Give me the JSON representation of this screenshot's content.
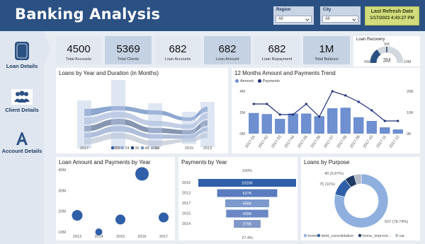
{
  "header": {
    "title": "Banking Analysis",
    "region": {
      "label": "Region",
      "value": "All"
    },
    "city": {
      "label": "City",
      "value": "All"
    },
    "refresh_label": "Last Refresh Date",
    "refresh_value": "1/17/2023 4:43:27 PM"
  },
  "nav": [
    {
      "label": "Loan Details",
      "icon": "document-icon"
    },
    {
      "label": "Client Details",
      "icon": "people-icon"
    },
    {
      "label": "Account Details",
      "icon": "letter-a-icon"
    }
  ],
  "kpis": [
    {
      "value": "4500",
      "label": "Total Accounts"
    },
    {
      "value": "5369",
      "label": "Total Clients"
    },
    {
      "value": "682",
      "label": "Loan Accounts"
    },
    {
      "value": "682",
      "label": "Loan Amount"
    },
    {
      "value": "682",
      "label": "Loan Repayment"
    },
    {
      "value": "1M",
      "label": "Total Balance"
    }
  ],
  "gauge": {
    "title": "Loan Recovery",
    "min_label": "0M",
    "max_label": "10M",
    "target_label": "5M",
    "value_label": "3M",
    "value_fraction": 0.3
  },
  "ribbon": {
    "title": "Loans by Year and Duration (in Months)",
    "x_labels": [
      "2017",
      "2016",
      "2014",
      "2015",
      "2013"
    ],
    "legend": [
      "12",
      "24",
      "36",
      "48",
      "60"
    ],
    "colors": [
      "#2f5fa8",
      "#8ea6cf",
      "#233f72",
      "#6e8bbd",
      "#a9b5c6"
    ]
  },
  "trend": {
    "title": "12 Months Amount and Payments Trend",
    "legend_amount": "Amount",
    "legend_payments": "Payments",
    "y_left": [
      "4M",
      "2M",
      "0M"
    ],
    "y_right": [
      "20K",
      "10K",
      "0K"
    ]
  },
  "scatter": {
    "title": "Loan Amount and Payments by Year",
    "y_ticks": [
      "40M",
      "30M",
      "20M",
      "10M"
    ]
  },
  "funnel": {
    "title": "Payments by Year",
    "top_label": "100%",
    "bottom_label": "27.4%",
    "rows": [
      {
        "year": "2016",
        "label": "1020K",
        "value": 1020
      },
      {
        "year": "2013",
        "label": "627K",
        "value": 627
      },
      {
        "year": "2017",
        "label": "458K",
        "value": 458
      },
      {
        "year": "2015",
        "label": "439K",
        "value": 439
      },
      {
        "year": "2014",
        "label": "279K",
        "value": 279
      }
    ]
  },
  "donut": {
    "title": "Loans by Purpose",
    "labels": [
      "40 (5.87%)",
      "75 (11%)",
      "537 (78.74%)"
    ],
    "legend": [
      "home",
      "debt_consolidation",
      "home_improve...",
      "car"
    ],
    "colors": [
      "#8fb0de",
      "#2f5fa8",
      "#1f3a64",
      "#b5bdc8"
    ]
  },
  "chart_data": [
    {
      "type": "bar",
      "title": "12 Months Amount and Payments Trend",
      "categories": [
        "2017-01",
        "2017-02",
        "2017-03",
        "2017-04",
        "2017-05",
        "2017-06",
        "2017-07",
        "2017-08",
        "2017-09",
        "2017-10",
        "2017-11",
        "2017-12"
      ],
      "series": [
        {
          "name": "Amount",
          "axis": "left",
          "values": [
            1.95,
            1.85,
            1.4,
            1.9,
            1.9,
            1.65,
            2.4,
            2.45,
            1.55,
            1.2,
            0.6,
            0.4
          ]
        },
        {
          "name": "Payments",
          "type": "line",
          "axis": "right",
          "values": [
            14,
            14,
            9,
            9,
            14,
            8,
            20,
            18,
            15,
            11,
            6,
            6
          ]
        }
      ],
      "ylim": [
        0,
        4
      ],
      "ylim_right": [
        0,
        20
      ]
    },
    {
      "type": "scatter",
      "title": "Loan Amount and Payments by Year",
      "x": [
        2013,
        2014,
        2015,
        2016,
        2017
      ],
      "y": [
        18,
        10,
        16,
        38,
        17
      ],
      "x_labels": [
        "2013",
        "2014",
        "2015",
        "2016",
        "2017"
      ],
      "ylim": [
        10,
        40
      ]
    },
    {
      "type": "bar",
      "title": "Payments by Year",
      "categories": [
        "2016",
        "2013",
        "2017",
        "2015",
        "2014"
      ],
      "values": [
        1020,
        627,
        458,
        439,
        279
      ]
    },
    {
      "type": "pie",
      "title": "Loans by Purpose",
      "categories": [
        "home",
        "debt_consolidation",
        "home_improve...",
        "car"
      ],
      "values": [
        537,
        75,
        40,
        30
      ]
    }
  ]
}
